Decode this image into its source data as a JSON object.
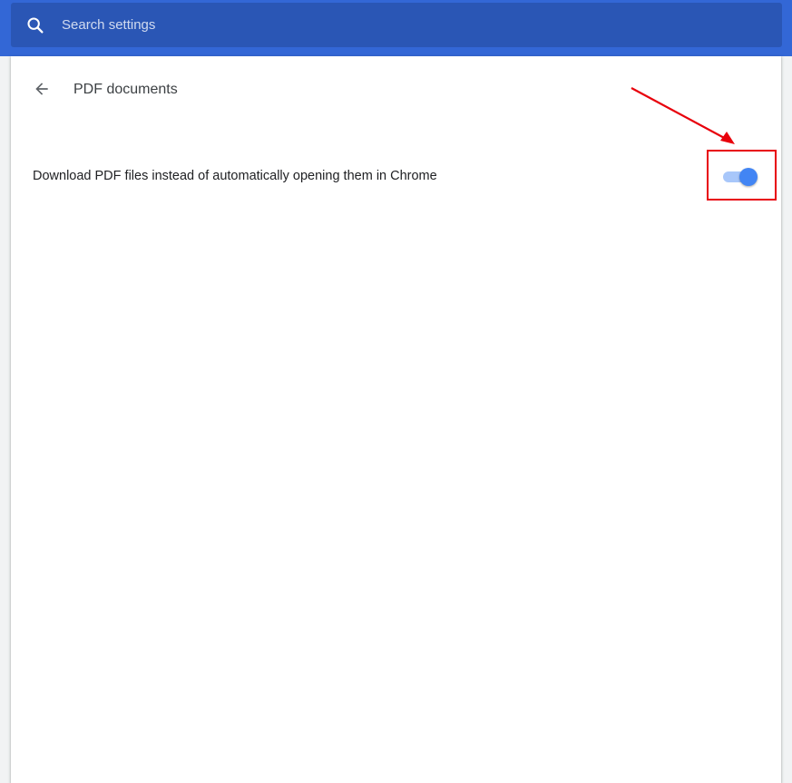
{
  "search": {
    "placeholder": "Search settings",
    "value": ""
  },
  "page": {
    "title": "PDF documents"
  },
  "settings": [
    {
      "label": "Download PDF files instead of automatically opening them in Chrome",
      "enabled": true
    }
  ],
  "icons": {
    "search": "search-icon",
    "back": "back-arrow-icon"
  },
  "colors": {
    "header": "#3367d6",
    "search_box": "#2a56b5",
    "toggle_on": "#4285f4",
    "toggle_track_on": "#a8c7fa",
    "annotation": "#e8000b"
  }
}
